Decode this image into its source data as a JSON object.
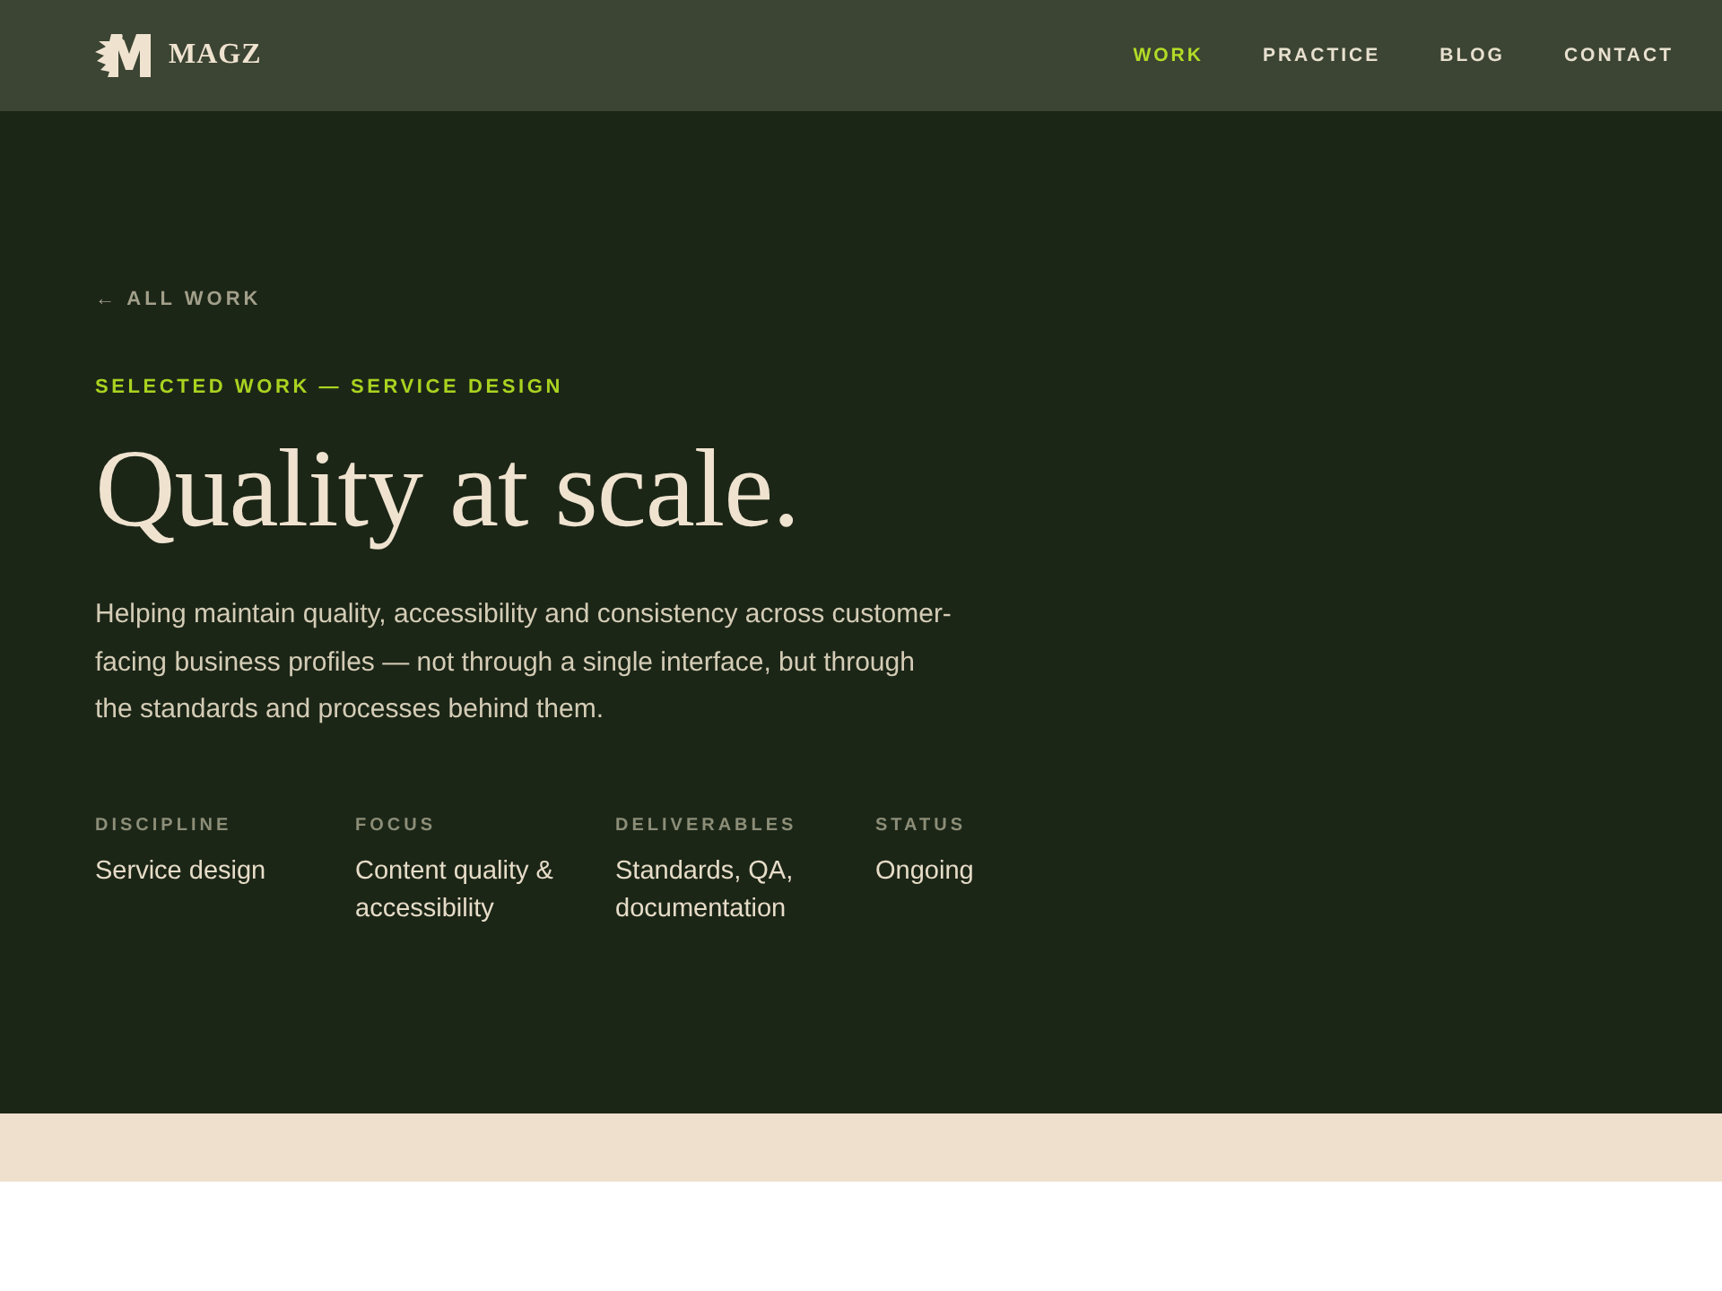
{
  "header": {
    "brand": "MAGZ",
    "nav": [
      {
        "label": "WORK",
        "selected": true
      },
      {
        "label": "PRACTICE",
        "selected": false
      },
      {
        "label": "BLOG",
        "selected": false
      },
      {
        "label": "CONTACT",
        "selected": false
      }
    ]
  },
  "hero": {
    "back_link": "← ALL WORK",
    "eyebrow": "SELECTED WORK — SERVICE DESIGN",
    "title": "Quality at scale.",
    "intro": "Helping maintain quality, accessibility and consistency across customer-facing business profiles — not through a single interface, but through the standards and processes behind them.",
    "meta": [
      {
        "label": "DISCIPLINE",
        "value": "Service design"
      },
      {
        "label": "FOCUS",
        "value": "Content quality & accessibility"
      },
      {
        "label": "DELIVERABLES",
        "value": "Standards, QA, documentation"
      },
      {
        "label": "STATUS",
        "value": "Ongoing"
      }
    ]
  }
}
